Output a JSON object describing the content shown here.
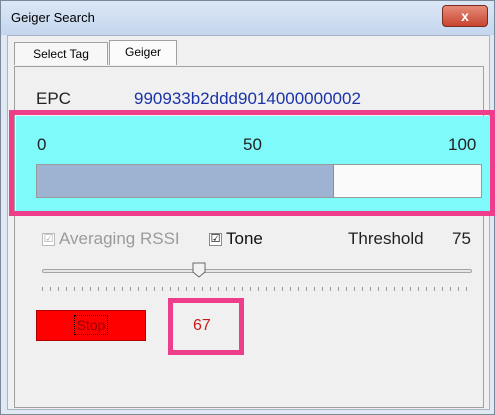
{
  "window": {
    "title": "Geiger Search",
    "close_label": "x"
  },
  "tabs": [
    {
      "label": "Select Tag"
    },
    {
      "label": "Geiger"
    }
  ],
  "epc": {
    "label": "EPC",
    "value": "990933b2ddd9014000000002"
  },
  "scale": {
    "min": "0",
    "mid": "50",
    "max": "100"
  },
  "signal_bar": {
    "level_percent": 67
  },
  "options": {
    "averaging_rssi_label": "Averaging RSSI",
    "averaging_checked": true,
    "tone_label": "Tone",
    "tone_checked": true
  },
  "threshold": {
    "label": "Threshold",
    "value": "75"
  },
  "slider": {
    "value": 75
  },
  "stop_button": {
    "label": "Stop"
  },
  "reading": {
    "value": "67"
  },
  "colors": {
    "highlight": "#ee3d8b",
    "band": "#7ffafa",
    "stop": "#ff0000",
    "epc_text": "#1a33a8"
  },
  "check_glyph": "☑"
}
